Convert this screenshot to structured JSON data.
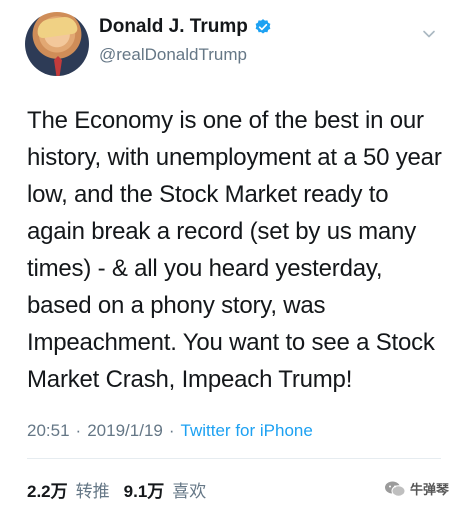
{
  "author": {
    "display_name": "Donald J. Trump",
    "handle": "@realDonaldTrump",
    "verified": true
  },
  "tweet": {
    "text": "The Economy is one of the best in our history, with unemployment at a 50 year low, and the Stock Market ready to again break a record (set by us many times) - & all you heard yesterday, based on a phony story, was Impeachment. You want to see a Stock Market Crash, Impeach Trump!",
    "time": "20:51",
    "date": "2019/1/19",
    "source": "Twitter for iPhone",
    "separator": "·"
  },
  "stats": {
    "retweets_value": "2.2万",
    "retweets_label": "转推",
    "likes_value": "9.1万",
    "likes_label": "喜欢"
  },
  "watermark": {
    "text": "牛弹琴"
  },
  "colors": {
    "accent": "#1da1f2",
    "secondary_text": "#657786",
    "primary_text": "#14171a"
  }
}
